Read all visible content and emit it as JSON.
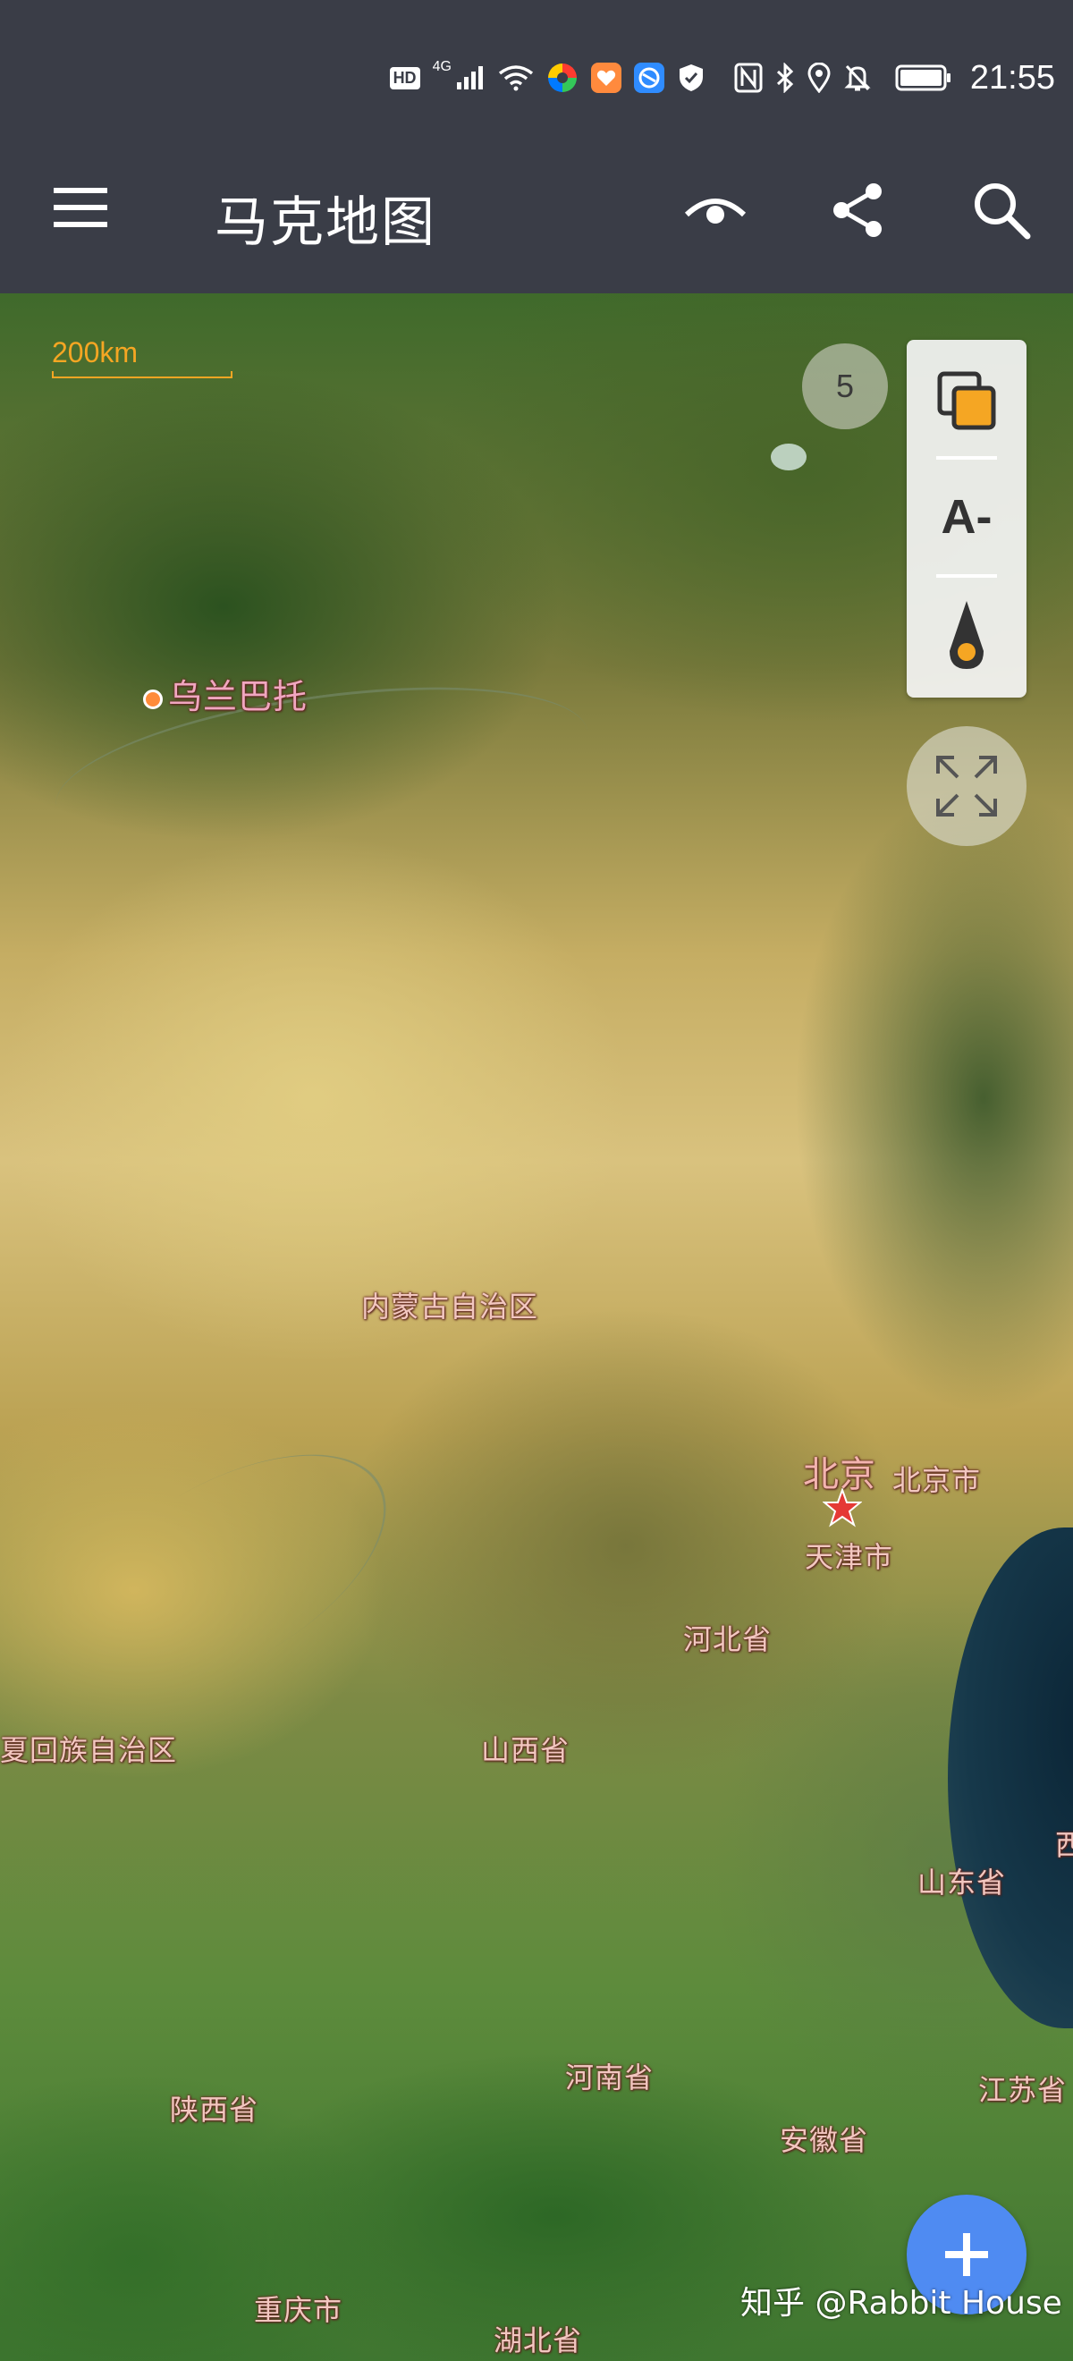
{
  "status_bar": {
    "hd": "HD",
    "network": "4G",
    "time": "21:55",
    "icons": [
      "hd-icon",
      "signal-icon",
      "wifi-icon",
      "app-icon-color",
      "app-icon-orange",
      "app-icon-blue",
      "shield-icon",
      "nfc-icon",
      "bluetooth-icon",
      "location-icon",
      "mute-icon",
      "battery-icon"
    ]
  },
  "app_bar": {
    "title": "马克地图",
    "icons": [
      "menu-icon",
      "eye-icon",
      "share-icon",
      "search-icon"
    ]
  },
  "map": {
    "scale_label": "200km",
    "zoom_level": "5",
    "tools": {
      "font_label": "A-"
    },
    "labels": {
      "ulaanbaatar": "乌兰巴托",
      "inner_mongolia": "内蒙古自治区",
      "beijing": "北京",
      "beijing_city": "北京市",
      "tianjin": "天津市",
      "hebei": "河北省",
      "ningxia": "夏回族自治区",
      "shanxi": "山西省",
      "shandong": "山东省",
      "shaanxi": "陕西省",
      "henan": "河南省",
      "jiangsu": "江苏省",
      "anhui": "安徽省",
      "chongqing": "重庆市",
      "hubei": "湖北省",
      "edge_label": "西"
    }
  },
  "watermark": "知乎 @Rabbit House",
  "colors": {
    "accent": "#f5a623",
    "fab": "#4f8bf2",
    "bar": "#3a3d47",
    "capital_star": "#e53935"
  }
}
